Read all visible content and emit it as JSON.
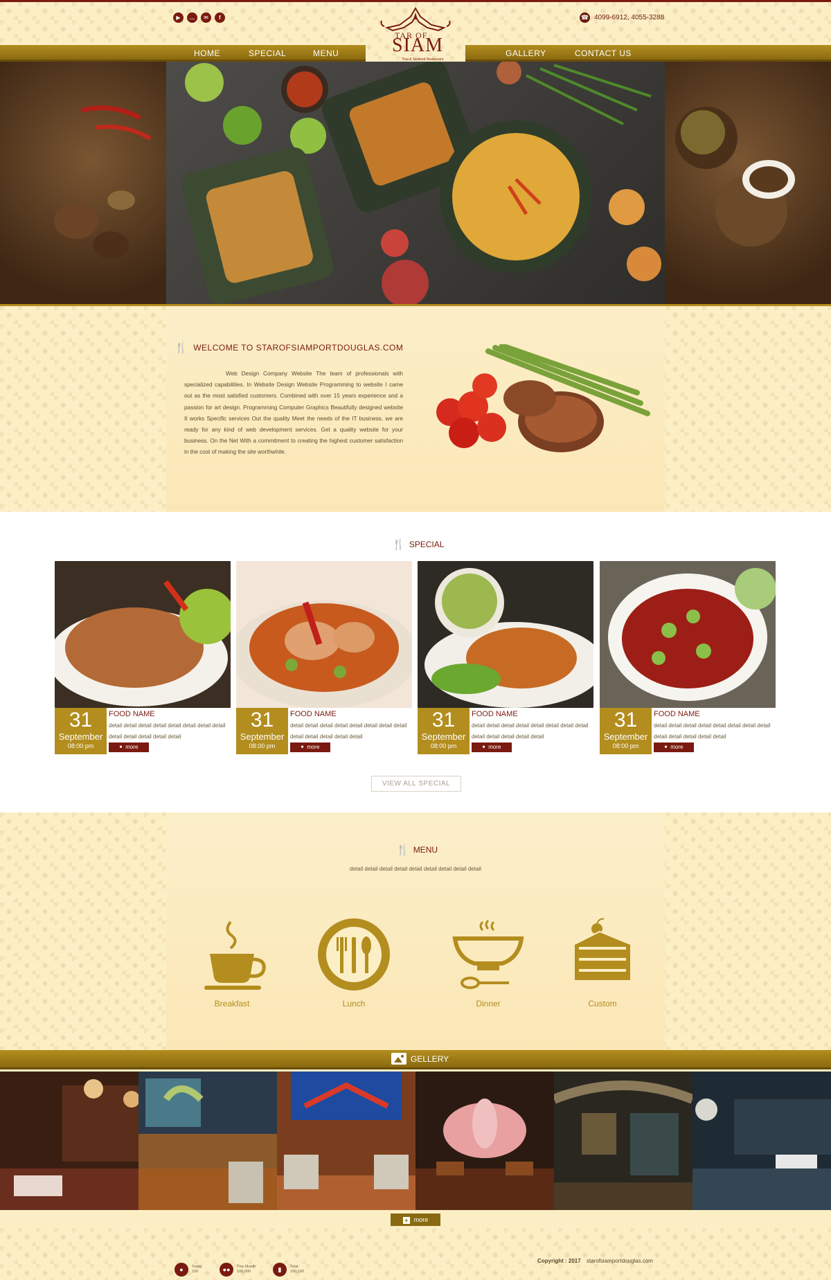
{
  "header": {
    "social": [
      {
        "name": "youtube",
        "glyph": "▶"
      },
      {
        "name": "chat",
        "glyph": "…"
      },
      {
        "name": "mail",
        "glyph": "✉"
      },
      {
        "name": "facebook",
        "glyph": "f"
      }
    ],
    "phone": "4099-6912, 4055-3288",
    "logo": {
      "line1": "TAR OF",
      "line2": "SIAM",
      "tagline": "Thai & Seafood Restaurant"
    },
    "nav_left": [
      "HOME",
      "SPECIAL",
      "MENU"
    ],
    "nav_right": [
      "GALLERY",
      "CONTACT US"
    ]
  },
  "welcome": {
    "title": "WELCOME TO STAROFSIAMPORTDOUGLAS.COM",
    "text": "Web Design Company Website The team of professionals with specialized capabilities. In Website Design Website Programming to website I came out as the most satisfied customers. Combined with over 15 years experience and a passion for art design. Programming Computer Graphics Beautifully designed website It works Specific services Out the quality Meet the needs of the IT business. we are ready for any kind of web development services. Get a quality website for your business. On the Net With a commitment to creating the highest customer satisfaction in the cost of making the site worthwhile."
  },
  "special": {
    "title": "SPECIAL",
    "cards": [
      {
        "day": "31",
        "month": "September",
        "time": "08:00 pm",
        "name": "FOOD NAME",
        "detail": "detail detail detail detail detail detail detail detail detail detail detail detail detail",
        "more": "more"
      },
      {
        "day": "31",
        "month": "September",
        "time": "08:00 pm",
        "name": "FOOD NAME",
        "detail": "detail detail detail detail detail detail detail detail detail detail detail detail detail",
        "more": "more"
      },
      {
        "day": "31",
        "month": "September",
        "time": "08:00 pm",
        "name": "FOOD NAME",
        "detail": "detail detail detail detail detail detail detail detail detail detail detail detail detail",
        "more": "more"
      },
      {
        "day": "31",
        "month": "September",
        "time": "08:00 pm",
        "name": "FOOD NAME",
        "detail": "detail detail detail detail detail detail detail detail detail detail detail detail detail",
        "more": "more"
      }
    ],
    "view_all": "VIEW ALL SPECIAL"
  },
  "menu": {
    "title": "MENU",
    "sub": "detail detail detail detail detail detail detail detail detail",
    "items": [
      {
        "label": "Breakfast",
        "icon": "coffee-cup-icon"
      },
      {
        "label": "Lunch",
        "icon": "plate-cutlery-icon"
      },
      {
        "label": "Dinner",
        "icon": "bowl-spoon-icon"
      },
      {
        "label": "Custom",
        "icon": "cake-icon"
      }
    ]
  },
  "gallery": {
    "title": "GELLERY",
    "more": "more"
  },
  "footer": {
    "stats": [
      {
        "label": "Today",
        "value": "100"
      },
      {
        "label": "This Month",
        "value": "100,000"
      },
      {
        "label": "Total",
        "value": "100,100"
      }
    ],
    "copyright_label": "Copyright",
    "copyright_year": "2017",
    "copyright_site": "starofsiamportdouglas.com"
  },
  "colors": {
    "gold": "#b38d1e",
    "maroon": "#7a1a10",
    "cream": "#fcefc6"
  }
}
